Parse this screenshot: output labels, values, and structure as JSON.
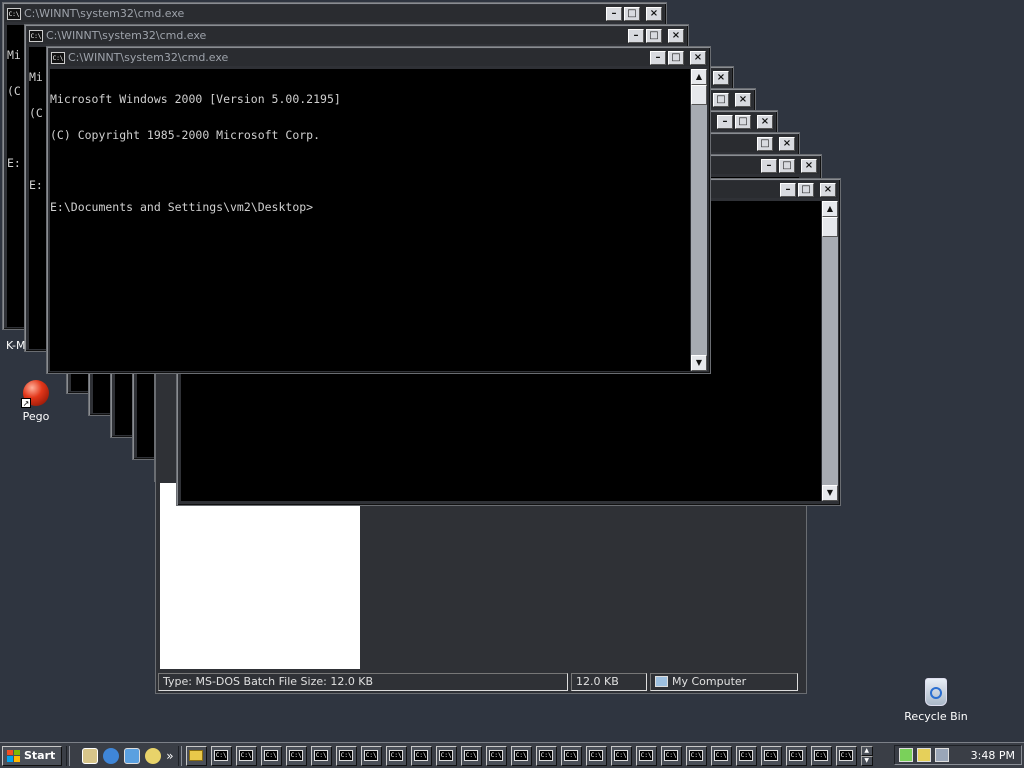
{
  "windows": {
    "cmd_title": "C:\\WINNT\\system32\\cmd.exe",
    "cmd_icon_text": "C:\\",
    "console_lines": [
      "Microsoft Windows 2000 [Version 5.00.2195]",
      "(C) Copyright 1985-2000 Microsoft Corp.",
      "",
      "E:\\Documents and Settings\\vm2\\Desktop>"
    ],
    "back_console_fragments": [
      "Mi",
      "(C",
      "",
      "E:"
    ],
    "back_console_fragments2": [
      "Mi",
      "(C",
      "",
      "E:"
    ]
  },
  "explorer": {
    "status_type": "Type: MS-DOS Batch File Size: 12.0 KB",
    "status_size": "12.0 KB",
    "status_zone": "My Computer"
  },
  "desktop": {
    "icon_pego": "Pego",
    "icon_recycle": "Recycle Bin",
    "partial_label": "K-M"
  },
  "taskbar": {
    "start_label": "Start",
    "overflow": "»",
    "clock": "3:48 PM",
    "task_count": 26,
    "start_logo_colors": [
      "#f25022",
      "#7fba00",
      "#00a4ef",
      "#ffb900"
    ]
  }
}
